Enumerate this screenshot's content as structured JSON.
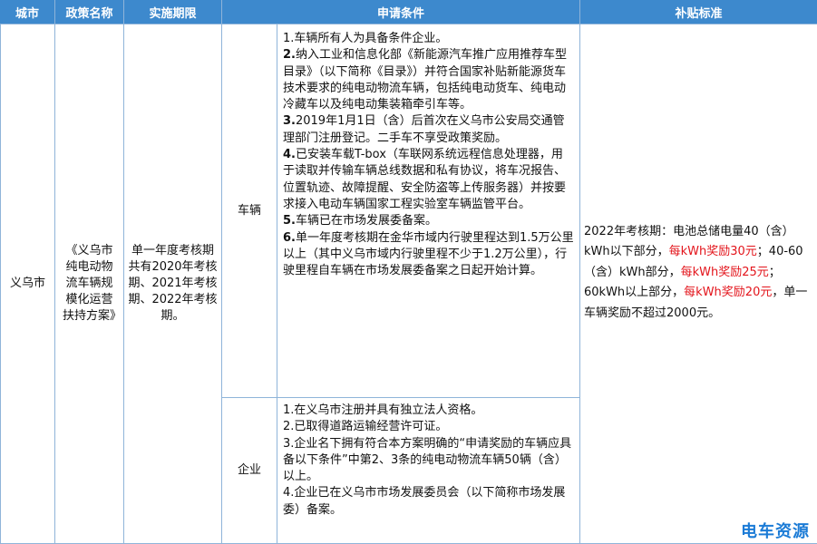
{
  "headers": {
    "city": "城市",
    "policy_name": "政策名称",
    "period": "实施期限",
    "conditions": "申请条件",
    "subsidy": "补贴标准"
  },
  "row": {
    "city": "义乌市",
    "policy_name": "《义乌市纯电动物流车辆规模化运营扶持方案》",
    "period": "单一年度考核期共有2020年考核期、2021年考核期、2022年考核期。",
    "vehicle_label": "车辆",
    "vehicle_conditions": [
      {
        "num": "",
        "text": "1.车辆所有人为具备条件企业。"
      },
      {
        "num": "2.",
        "text": "纳入工业和信息化部《新能源汽车推广应用推荐车型目录》（以下简称《目录》）并符合国家补贴新能源货车技术要求的纯电动物流车辆，包括纯电动货车、纯电动冷藏车以及纯电动集装箱牵引车等。"
      },
      {
        "num": "3.",
        "text": "2019年1月1日（含）后首次在义乌市公安局交通管理部门注册登记。二手车不享受政策奖励。"
      },
      {
        "num": "4.",
        "text": "已安装车载T-box（车联网系统远程信息处理器，用于读取并传输车辆总线数据和私有协议，将车况报告、位置轨迹、故障提醒、安全防盗等上传服务器）并按要求接入电动车辆国家工程实验室车辆监管平台。"
      },
      {
        "num": "5.",
        "text": "车辆已在市场发展委备案。"
      },
      {
        "num": "6.",
        "text": "单一年度考核期在金华市域内行驶里程达到1.5万公里以上（其中义乌市域内行驶里程不少于1.2万公里），行驶里程自车辆在市场发展委备案之日起开始计算。"
      }
    ],
    "enterprise_label": "企业",
    "enterprise_conditions": [
      "1.在义乌市注册并具有独立法人资格。",
      "2.已取得道路运输经营许可证。",
      "3.企业名下拥有符合本方案明确的“申请奖励的车辆应具备以下条件”中第2、3条的纯电动物流车辆50辆（含）以上。",
      "4.企业已在义乌市市场发展委员会（以下简称市场发展委）备案。"
    ],
    "subsidy": {
      "p1": "2022年考核期：电池总储电量40（含）kWh以下部分，",
      "r1": "每kWh奖励30元",
      "p2": "；40-60（含）kWh部分，",
      "r2": "每kWh奖励25元",
      "p3": "；60kWh以上部分，",
      "r3": "每kWh奖励20元",
      "p4": "，单一车辆奖励不超过2000元。"
    }
  },
  "watermark": "电车资源",
  "colors": {
    "header_bg": "#3d89cd",
    "border": "#8fb4d9",
    "highlight": "#e3141b",
    "watermark": "#1b7bd6"
  }
}
